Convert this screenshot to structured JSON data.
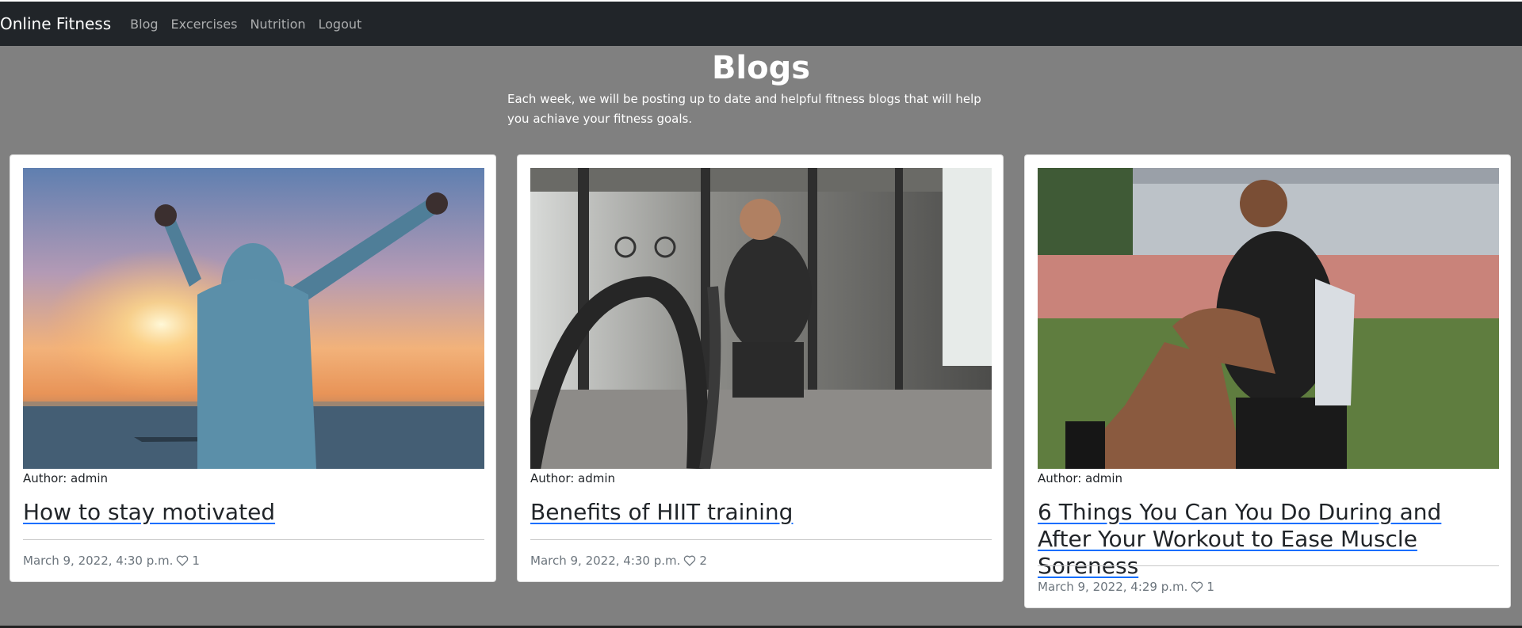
{
  "navbar": {
    "brand": "Online Fitness",
    "links": [
      "Blog",
      "Excercises",
      "Nutrition",
      "Logout"
    ]
  },
  "hero": {
    "title": "Blogs",
    "description": "Each week, we will be posting up to date and helpful fitness blogs that will help you achiave your fitness goals."
  },
  "posts": [
    {
      "image": "sunset-hoodie-arms-raised-image",
      "author": "Author: admin",
      "title": "How to stay motivated",
      "date": "March 9, 2022, 4:30 p.m.",
      "likes": "1"
    },
    {
      "image": "battle-ropes-gym-image",
      "author": "Author: admin",
      "title": "Benefits of HIIT training",
      "date": "March 9, 2022, 4:30 p.m.",
      "likes": "2"
    },
    {
      "image": "athlete-knee-pain-track-image",
      "author": "Author: admin",
      "title": "6 Things You Can You Do During and After Your Workout to Ease Muscle Soreness",
      "date": "March 9, 2022, 4:29 p.m.",
      "likes": "1"
    }
  ],
  "colors": {
    "navbar": "#212529",
    "page_background": "#808080",
    "link_underline": "#0d6efd"
  }
}
